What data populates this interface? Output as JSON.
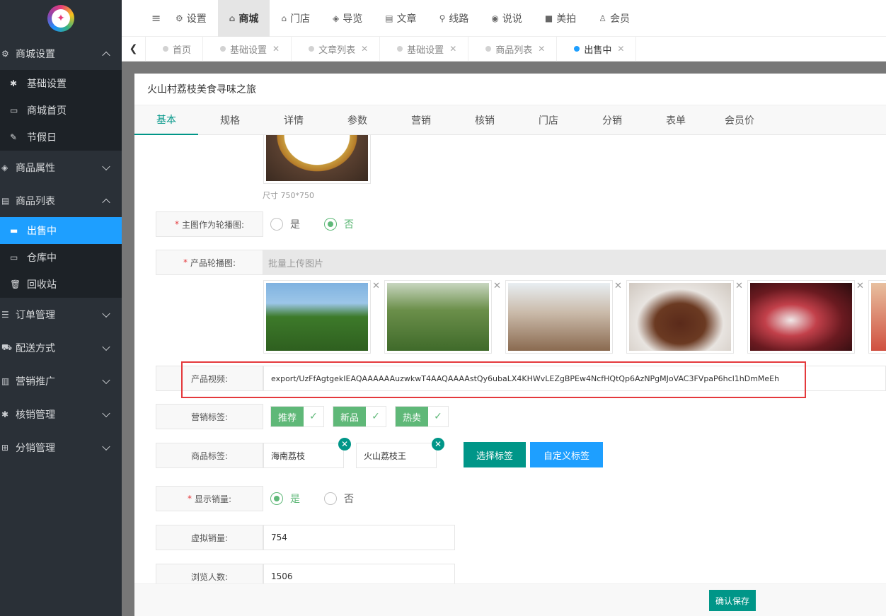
{
  "sidebar": {
    "groups": [
      {
        "label": "商城设置",
        "expanded": true
      },
      {
        "label": "商品属性",
        "expanded": false
      },
      {
        "label": "商品列表",
        "expanded": true
      },
      {
        "label": "订单管理",
        "expanded": false
      },
      {
        "label": "配送方式",
        "expanded": false
      },
      {
        "label": "营销推广",
        "expanded": false
      },
      {
        "label": "核销管理",
        "expanded": false
      },
      {
        "label": "分销管理",
        "expanded": false
      }
    ],
    "shop_sub": [
      "基础设置",
      "商城首页",
      "节假日"
    ],
    "list_sub": [
      "出售中",
      "仓库中",
      "回收站"
    ]
  },
  "topnav": {
    "items": [
      "设置",
      "商城",
      "门店",
      "导览",
      "文章",
      "线路",
      "说说",
      "美拍",
      "会员"
    ]
  },
  "tabs": [
    {
      "label": "首页",
      "closable": false
    },
    {
      "label": "基础设置",
      "closable": true
    },
    {
      "label": "文章列表",
      "closable": true
    },
    {
      "label": "基础设置",
      "closable": true
    },
    {
      "label": "商品列表",
      "closable": true
    },
    {
      "label": "出售中",
      "closable": true
    }
  ],
  "modal": {
    "title": "火山村荔枝美食寻味之旅",
    "tabs": [
      "基本",
      "规格",
      "详情",
      "参数",
      "营销",
      "核销",
      "门店",
      "分销",
      "表单",
      "会员价"
    ],
    "size_hint": "尺寸 750*750",
    "main_as_carousel": {
      "label": "主图作为轮播图:",
      "yes": "是",
      "no": "否",
      "selected": "否"
    },
    "carousel": {
      "label": "产品轮播图:",
      "placeholder": "批量上传图片"
    },
    "video": {
      "label": "产品视频:",
      "value": "export/UzFfAgtgekIEAQAAAAAAuzwkwT4AAQAAAAstQy6ubaLX4KHWvLEZgBPEw4NcfHQtQp6AzNPgMJoVAC3FVpaP6hcl1hDmMeEh"
    },
    "marketing": {
      "label": "营销标签:",
      "tags": [
        "推荐",
        "新品",
        "热卖"
      ]
    },
    "product_tags": {
      "label": "商品标签:",
      "tags": [
        "海南荔枝",
        "火山荔枝王"
      ],
      "select_btn": "选择标签",
      "custom_btn": "自定义标签"
    },
    "show_sales": {
      "label": "显示销量:",
      "yes": "是",
      "no": "否",
      "selected": "是"
    },
    "virtual_sales": {
      "label": "虚拟销量:",
      "value": "754"
    },
    "views": {
      "label": "浏览人数:",
      "value": "1506"
    },
    "save": "确认保存"
  },
  "colors": {
    "accent": "#009688",
    "blue": "#1e9fff",
    "green": "#5fb878",
    "highlight": "#e4393c"
  }
}
